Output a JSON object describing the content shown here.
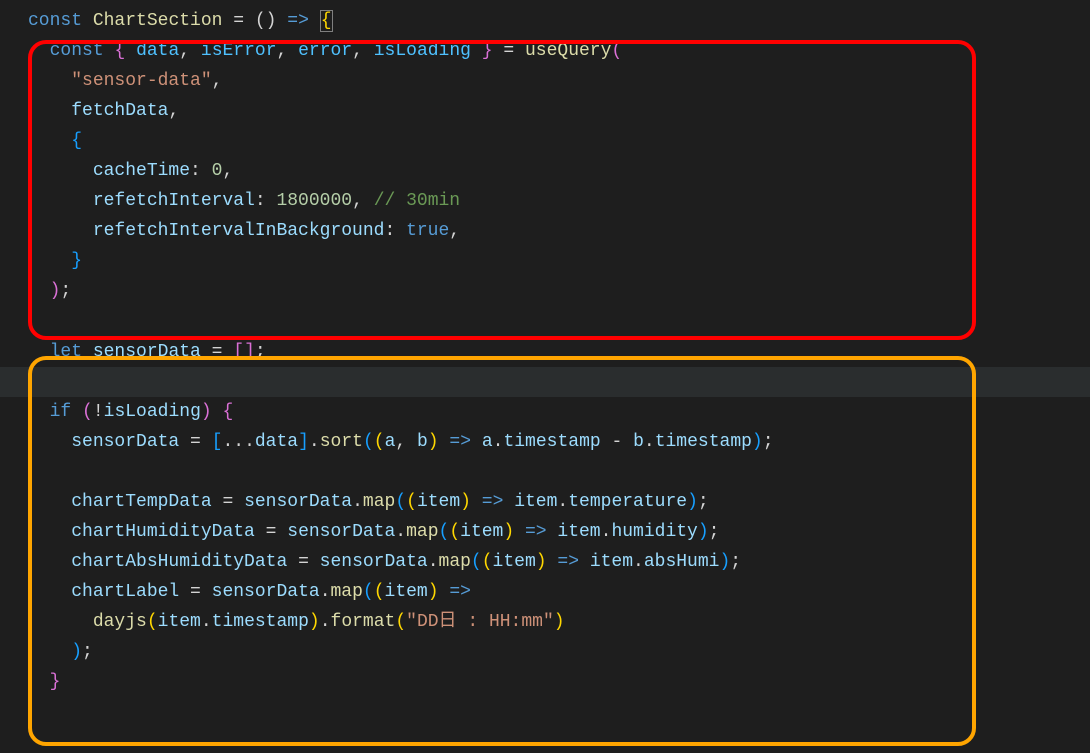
{
  "code": {
    "l1": {
      "const": "const",
      "name": "ChartSection",
      "eq": " = () ",
      "arrow": "=>",
      "brace": " {"
    },
    "l2": {
      "const": "const",
      "destruct_open": "{ ",
      "v1": "data",
      "v2": "isError",
      "v3": "error",
      "v4": "isLoading",
      "destruct_close": " }",
      "eq": " = ",
      "fn": "useQuery",
      "paren": "("
    },
    "l3": {
      "str": "\"sensor-data\""
    },
    "l4": {
      "name": "fetchData"
    },
    "l5": {
      "brace": "{"
    },
    "l6": {
      "prop": "cacheTime",
      "colon": ": ",
      "val": "0",
      "comma": ","
    },
    "l7": {
      "prop": "refetchInterval",
      "colon": ": ",
      "val": "1800000",
      "comma": ",",
      "comment": " // 30min"
    },
    "l8": {
      "prop": "refetchIntervalInBackground",
      "colon": ": ",
      "val": "true",
      "comma": ","
    },
    "l9": {
      "brace": "}"
    },
    "l10": {
      "paren": ")",
      "semi": ";"
    },
    "l11": "",
    "l12": {
      "let": "let",
      "name": "sensorData",
      "eq": " = []",
      "semi": ";"
    },
    "l13": "",
    "l14": {
      "if": "if",
      "open": " (!",
      "name": "isLoading",
      "close": ") {"
    },
    "l15": {
      "lhs": "sensorData",
      "eq": " = [...",
      "rhs": "data",
      "bracket": "].",
      "fn": "sort",
      "args_open": "((",
      "a": "a",
      "comma": ", ",
      "b": "b",
      "args_close": ") ",
      "arrow": "=>",
      "expr_a": " a",
      "dot1": ".",
      "ts1": "timestamp",
      "minus": " - ",
      "expr_b": "b",
      "dot2": ".",
      "ts2": "timestamp",
      "end": ");"
    },
    "l16": "",
    "l17": {
      "lhs": "chartTempData",
      "eq": " = ",
      "src": "sensorData",
      "dot": ".",
      "fn": "map",
      "open": "((",
      "item": "item",
      "close": ") ",
      "arrow": "=>",
      "sp": " ",
      "i2": "item",
      "dot2": ".",
      "prop": "temperature",
      "end": ");"
    },
    "l18": {
      "lhs": "chartHumidityData",
      "eq": " = ",
      "src": "sensorData",
      "dot": ".",
      "fn": "map",
      "open": "((",
      "item": "item",
      "close": ") ",
      "arrow": "=>",
      "sp": " ",
      "i2": "item",
      "dot2": ".",
      "prop": "humidity",
      "end": ");"
    },
    "l19": {
      "lhs": "chartAbsHumidityData",
      "eq": " = ",
      "src": "sensorData",
      "dot": ".",
      "fn": "map",
      "open": "((",
      "item": "item",
      "close": ") ",
      "arrow": "=>",
      "sp": " ",
      "i2": "item",
      "dot2": ".",
      "prop": "absHumi",
      "end": ");"
    },
    "l20": {
      "lhs": "chartLabel",
      "eq": " = ",
      "src": "sensorData",
      "dot": ".",
      "fn": "map",
      "open": "((",
      "item": "item",
      "close": ") ",
      "arrow": "=>"
    },
    "l21": {
      "fn": "dayjs",
      "open": "(",
      "item": "item",
      "dot": ".",
      "prop": "timestamp",
      "close": ").",
      "fn2": "format",
      "open2": "(",
      "str": "\"DD日 : HH:mm\"",
      "close2": ")"
    },
    "l22": {
      "paren": ")",
      "semi": ";"
    },
    "l23": {
      "brace": "}"
    }
  }
}
